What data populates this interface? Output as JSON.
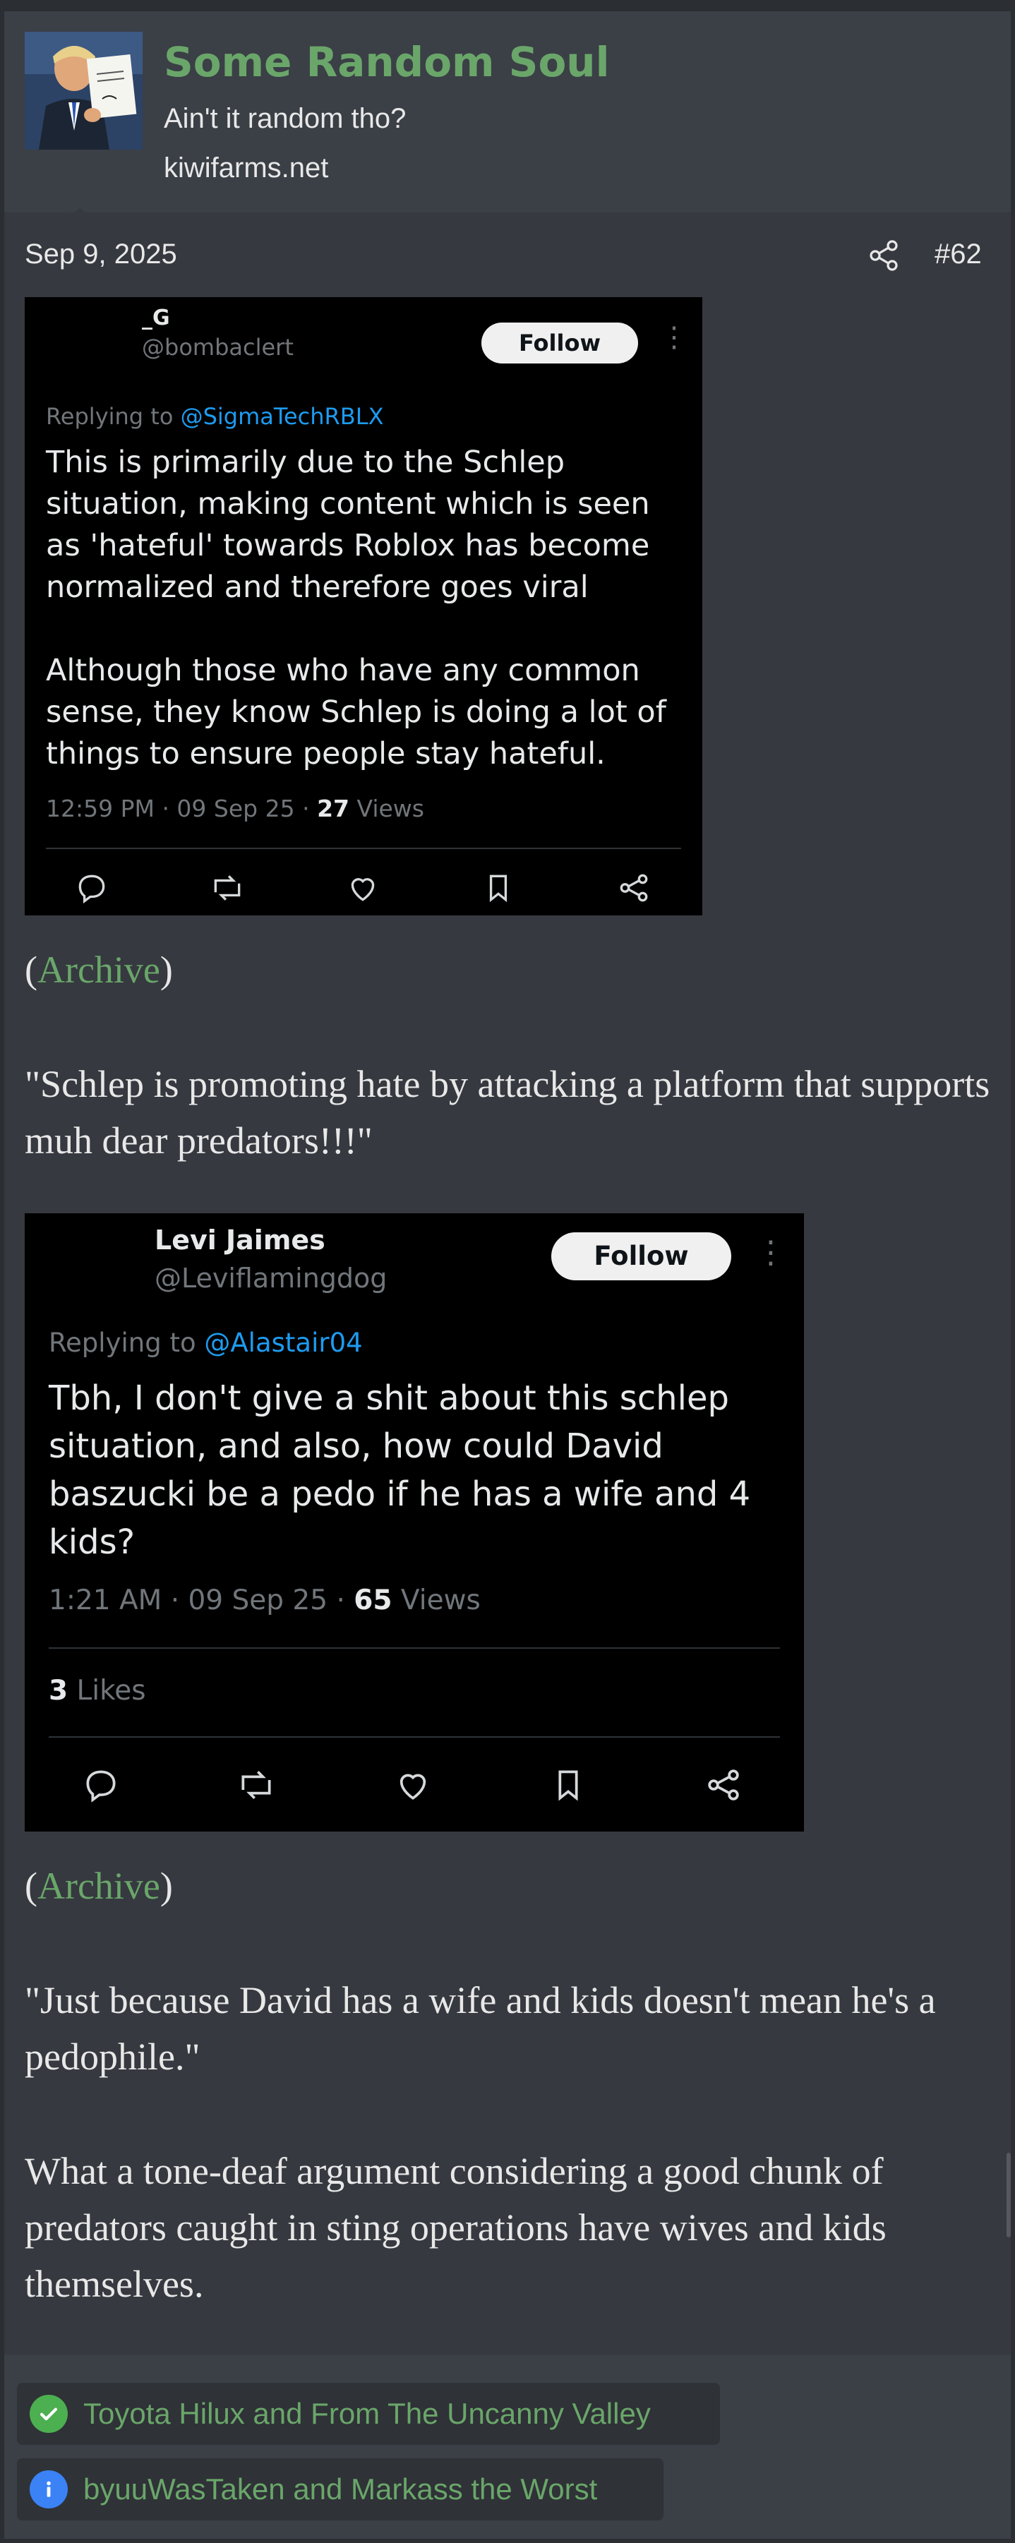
{
  "user": {
    "name": "Some Random Soul",
    "title": "Ain't it random tho?",
    "site": "kiwifarms.net"
  },
  "post": {
    "date": "Sep 9, 2025",
    "number": "#62"
  },
  "tweet1": {
    "name": "_G",
    "handle": "@bombaclert",
    "follow_label": "Follow",
    "reply_prefix": "Replying to ",
    "reply_mention": "@SigmaTechRBLX",
    "body": "This is primarily due to the Schlep\nsituation, making content which is seen\nas 'hateful' towards Roblox has become\nnormalized and therefore goes viral\n\nAlthough those who have any common\nsense, they know Schlep is doing a lot of\nthings to ensure people stay hateful.",
    "meta_time": "12:59 PM · 09 Sep 25 · ",
    "meta_views_count": "27",
    "meta_views_label": " Views"
  },
  "archive1": {
    "open": "(",
    "link": "Archive",
    "close": ")"
  },
  "quote1": "\"Schlep is promoting hate by attacking a platform that supports muh dear predators!!!\"",
  "tweet2": {
    "name": "Levi Jaimes",
    "handle": "@Leviflamingdog",
    "follow_label": "Follow",
    "reply_prefix": "Replying to ",
    "reply_mention": "@Alastair04",
    "body": "Tbh, I don't give a shit about this schlep\nsituation, and also, how could David\nbaszucki be a pedo if he has a wife and 4\nkids?",
    "meta_time": "1:21 AM · 09 Sep 25 · ",
    "meta_views_count": "65",
    "meta_views_label": " Views",
    "likes_count": "3",
    "likes_label": " Likes"
  },
  "archive2": {
    "open": "(",
    "link": "Archive",
    "close": ")"
  },
  "quote2": "\"Just because David has a wife and kids doesn't mean he's a pedophile.\"",
  "paragraph": "What a tone-deaf argument considering a good chunk of predators caught in sting operations have wives and kids themselves.",
  "reactions": [
    {
      "text": "Toyota Hilux and From The Uncanny Valley",
      "icon": "check-icon",
      "color": "#4caf50"
    },
    {
      "text": "byuuWasTaken and Markass the Worst",
      "icon": "info-icon",
      "color": "#3b82f6"
    }
  ],
  "colors": {
    "accent_green": "#6aa66a",
    "tweet_mention_blue": "#1d9bf0"
  }
}
